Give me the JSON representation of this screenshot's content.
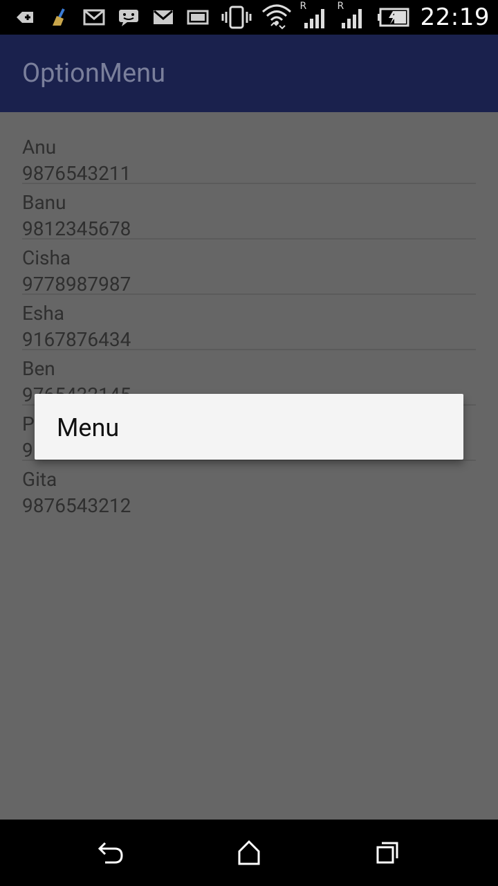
{
  "status_bar": {
    "time": "22:19",
    "left_icons": [
      "add-icon",
      "broom-icon",
      "gmail-icon",
      "message-icon",
      "gmail-icon",
      "image-icon"
    ],
    "right_icons": [
      "vibrate-icon",
      "wifi-icon",
      "signal-icon",
      "signal-icon",
      "battery-charging-icon"
    ],
    "roaming_label": "R"
  },
  "appbar": {
    "title": "OptionMenu"
  },
  "contacts": [
    {
      "name": "Anu",
      "phone": "9876543211"
    },
    {
      "name": "Banu",
      "phone": "9812345678"
    },
    {
      "name": "Cisha",
      "phone": "9778987987"
    },
    {
      "name": "Esha",
      "phone": "9167876434"
    },
    {
      "name": "Ben",
      "phone": "9765432145"
    },
    {
      "name": "P",
      "phone": "9"
    },
    {
      "name": "Gita",
      "phone": "9876543212"
    }
  ],
  "popup_menu": {
    "items": [
      {
        "label": "Menu"
      }
    ]
  },
  "nav_bar": {
    "icons": [
      "back-icon",
      "home-icon",
      "recents-icon"
    ]
  },
  "colors": {
    "appbar": "#1a214d",
    "scrim": "#666666",
    "menu_bg": "#f4f4f4"
  }
}
